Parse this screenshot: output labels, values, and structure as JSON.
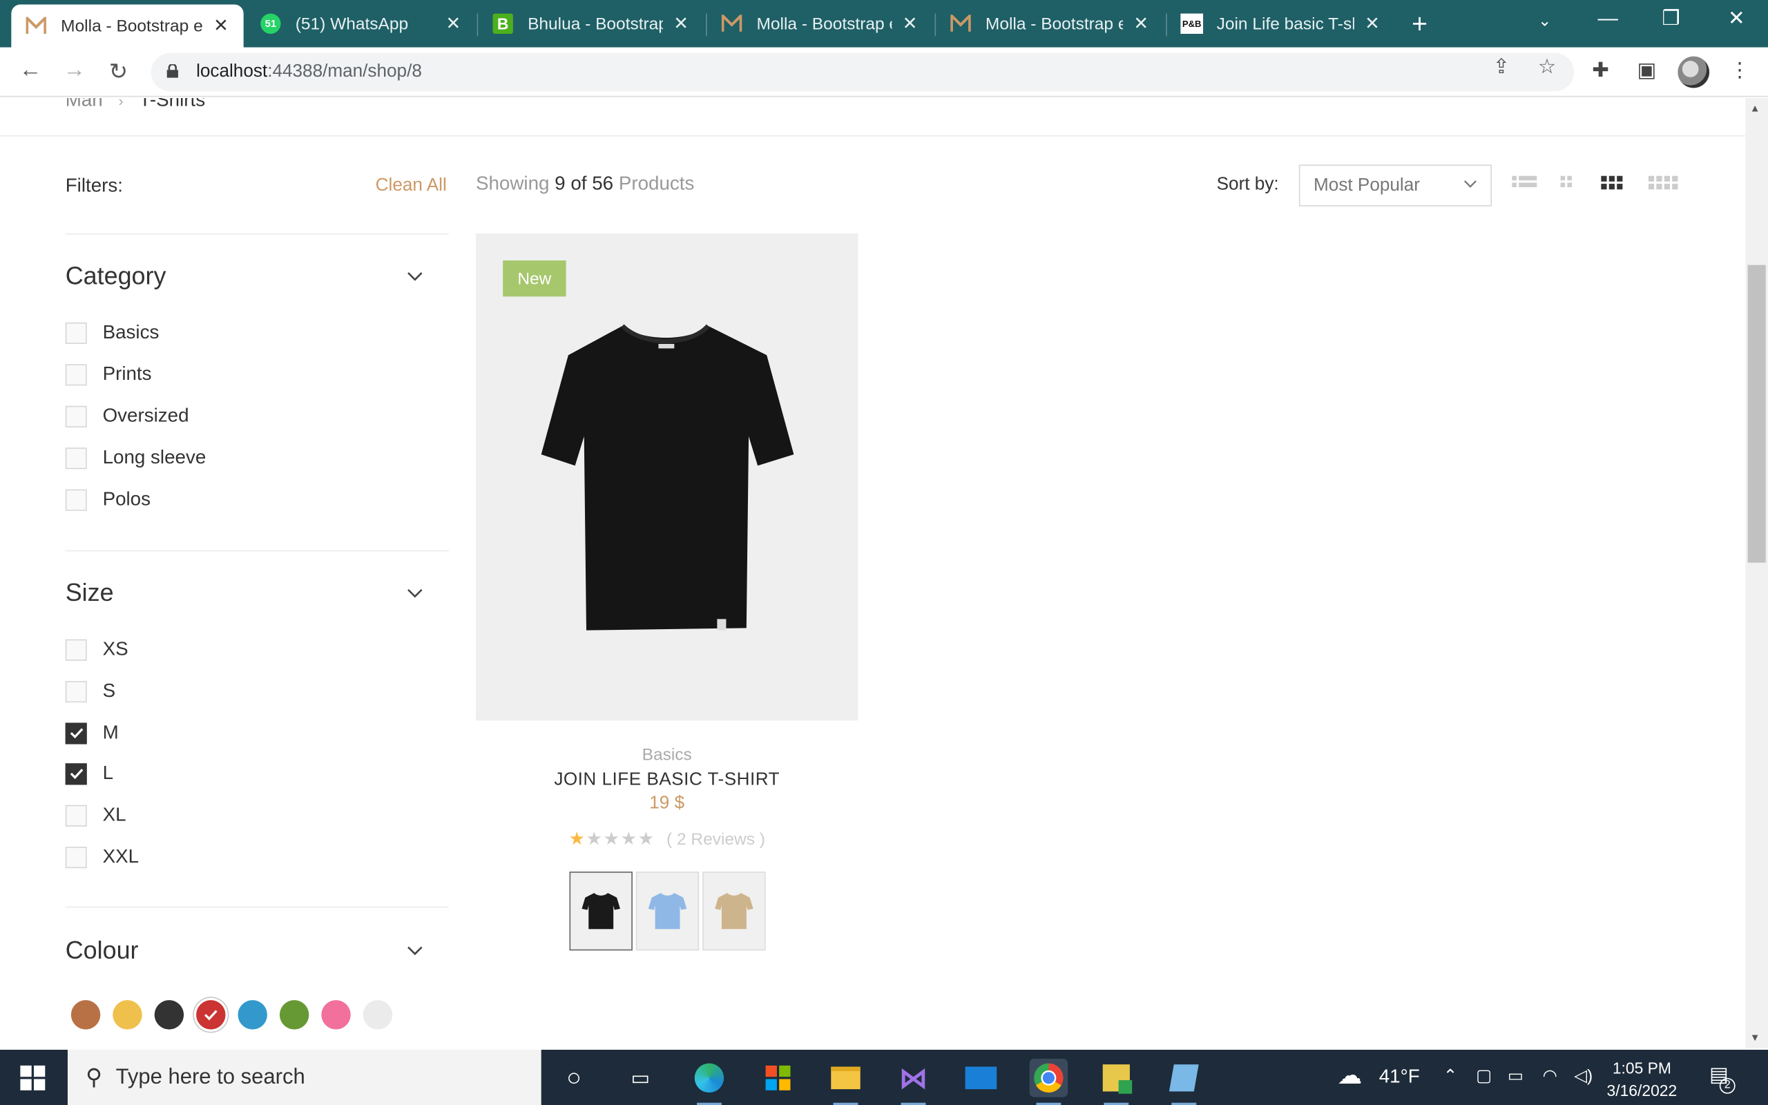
{
  "browser": {
    "tabs": [
      {
        "title": "Molla - Bootstrap e",
        "favicon": "molla-icon",
        "active": true
      },
      {
        "title": "(51) WhatsApp",
        "favicon": "whatsapp-icon",
        "active": false
      },
      {
        "title": "Bhulua - Bootstrap",
        "favicon": "bootstrap-b-icon",
        "active": false
      },
      {
        "title": "Molla - Bootstrap e",
        "favicon": "molla-icon",
        "active": false
      },
      {
        "title": "Molla - Bootstrap e",
        "favicon": "molla-icon",
        "active": false
      },
      {
        "title": "Join Life basic T-shi",
        "favicon": "pb-icon",
        "active": false
      }
    ],
    "favicon_badge": "51",
    "favicon_pb": "P&B",
    "url_host": "localhost",
    "url_rest": ":44388/man/shop/8"
  },
  "breadcrumb": {
    "items": [
      "Man",
      "T-Shirts"
    ]
  },
  "sidebar": {
    "filters_label": "Filters:",
    "clean_all": "Clean All",
    "category": {
      "title": "Category",
      "options": [
        {
          "label": "Basics",
          "checked": false
        },
        {
          "label": "Prints",
          "checked": false
        },
        {
          "label": "Oversized",
          "checked": false
        },
        {
          "label": "Long sleeve",
          "checked": false
        },
        {
          "label": "Polos",
          "checked": false
        }
      ]
    },
    "size": {
      "title": "Size",
      "options": [
        {
          "label": "XS",
          "checked": false
        },
        {
          "label": "S",
          "checked": false
        },
        {
          "label": "M",
          "checked": true
        },
        {
          "label": "L",
          "checked": true
        },
        {
          "label": "XL",
          "checked": false
        },
        {
          "label": "XXL",
          "checked": false
        }
      ]
    },
    "colour": {
      "title": "Colour",
      "swatches": [
        {
          "color": "#b87145",
          "selected": false
        },
        {
          "color": "#f0c04c",
          "selected": false
        },
        {
          "color": "#333333",
          "selected": false
        },
        {
          "color": "#cc3333",
          "selected": true
        },
        {
          "color": "#3399cc",
          "selected": false
        },
        {
          "color": "#669933",
          "selected": false
        },
        {
          "color": "#f2719c",
          "selected": false
        },
        {
          "color": "#ebebeb",
          "selected": false
        }
      ]
    }
  },
  "toolbox": {
    "showing_prefix": "Showing",
    "showing_count": "9 of 56",
    "showing_suffix": "Products",
    "sort_label": "Sort by:",
    "sort_value": "Most Popular"
  },
  "product": {
    "badge": "New",
    "category": "Basics",
    "name": "JOIN LIFE BASIC T-SHIRT",
    "price": "19 $",
    "rating": 1,
    "rating_max": 5,
    "reviews": "( 2 Reviews )",
    "variants": [
      {
        "color": "#1a1a1a",
        "active": true
      },
      {
        "color": "#8fb8e6",
        "active": false
      },
      {
        "color": "#cdb48c",
        "active": false
      }
    ]
  },
  "taskbar": {
    "search_placeholder": "Type here to search",
    "weather": "41°F",
    "time": "1:05 PM",
    "date": "3/16/2022",
    "notifications": "2"
  },
  "colors": {
    "accent": "#cc9966",
    "badge_new": "#a6c76c",
    "tabstrip": "#1f5f66",
    "taskbar": "#1d2b3a"
  }
}
